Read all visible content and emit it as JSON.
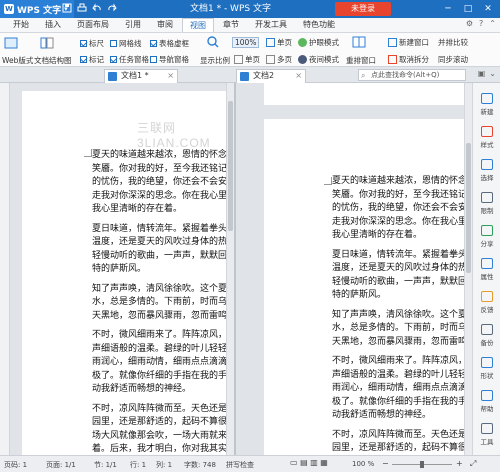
{
  "titlebar": {
    "app_name": "WPS 文字",
    "doc_title": "文档1 * - WPS 文字",
    "login_label": "未登录",
    "minimize": "─",
    "maximize": "□",
    "close": "✕"
  },
  "menu": {
    "tabs": [
      "开始",
      "插入",
      "页面布局",
      "引用",
      "审阅",
      "视图",
      "章节",
      "开发工具",
      "特色功能"
    ],
    "active_tab": "视图"
  },
  "ribbon": {
    "full_screen": "全屏显示",
    "read": "阅读版式",
    "doc_structure": "文档结构图",
    "web_view": "Web版式",
    "ruler": "标尺",
    "gridlines": "网格线",
    "table_grid": "表格虚框",
    "markers": "标记",
    "task_pane": "任务窗格",
    "nav_grid": "导航窗格",
    "show_hide": "显示比例",
    "zoom_value": "100%",
    "one_page": "单页",
    "multi_page": "多页",
    "page_width": "页宽",
    "eye_mode": "护眼模式",
    "night_mode": "夜间模式",
    "new_window": "新建窗口",
    "rearrange": "重排窗口",
    "cancel_split": "取消拆分",
    "side_by_side": "并排比较",
    "sync_scroll": "同步滚动"
  },
  "doctabs": {
    "tab1": "文档1 *",
    "tab2": "文档2",
    "search_placeholder": "点此查找命令(Alt+Q)"
  },
  "document": {
    "watermark": "三联网 3LIAN.COM",
    "left_paragraphs": [
      [
        "夏天的味道越来越浓，恩情的怀念越",
        "笑靥。你对我的好，至今我还铭记在心",
        "的忧伤，我的绝望，你还会不会安心",
        "走我对你深深的思念。你在我心里，无",
        "我心里清晰的存在着。"
      ],
      [
        "夏日味道，情转流年。紧握着拳头，到",
        "温度，还是夏天的风吹过身体的热度",
        "轻慢动听的歌曲，一声声，默默回落在",
        "特的萨斯风。"
      ],
      [
        "知了声声唤，清风徐徐吹。这个夏天",
        "水，总是多情的。下雨前，时而乌云",
        "天黑地，忽而暴风骤雨，忽而雷鸣闪"
      ],
      [
        "不时，微风细雨来了。阵阵凉风，吹",
        "声细语般的温柔。碧绿的叶儿轻轻的",
        "雨润心，细雨动情，细雨点点滴滴的",
        "极了。就像你纤细的手指在我的手掌",
        "动我舒适而畅想的神经。"
      ],
      [
        "不时，凉风阵阵微而至。天色还是",
        "园里，还是那舒适的，起码不算很热",
        "场大风就像那会吹，一场大雨就来那",
        "着。后来，我才明白，你对我其实是"
      ]
    ],
    "right_paragraphs": [
      [
        "夏天的味道越来越浓，恩情的怀念越",
        "笑靥。你对我的好，至今我还铭记在",
        "的忧伤，我的绝望，你还会不会安心",
        "走我对你深深的思念。你在我心里，",
        "我心里清晰的存在着。"
      ],
      [
        "夏日味道，情转流年。紧握着拳头，",
        "温度，还是夏天的风吹过身体的热度",
        "轻慢动听的歌曲，一声声，默默回落",
        "特的萨斯风。"
      ],
      [
        "知了声声唤，清风徐徐吹。这个夏天",
        "水，总是多情的。下雨前，时而乌云",
        "天黑地，忽而暴风骤雨，忽而雷鸣闪"
      ],
      [
        "不时，微风细雨来了。阵阵凉风，吹",
        "声细语般的温柔。碧绿的叶儿轻轻的",
        "雨润心，细雨动情，细雨点点滴滴的",
        "极了。就像你纤细的手指在我的手掌",
        "动我舒适而畅想的神经。"
      ],
      [
        "不时，凉风阵阵微而至。天色还是",
        "园里，还是那舒适的，起码不算很热",
        "场大风就像那会吹，一场大雨就"
      ]
    ]
  },
  "sidebar": [
    "新建",
    "样式",
    "选择",
    "限制",
    "分享",
    "属性",
    "反馈",
    "备份",
    "形状",
    "帮助",
    "工具"
  ],
  "status": {
    "page_no": "页码: 1",
    "pages": "页面: 1/1",
    "section": "节: 1/1",
    "row": "行: 1",
    "col": "列: 1",
    "words": "字数: 748",
    "spell": "拼写检查",
    "zoom": "100 %"
  }
}
